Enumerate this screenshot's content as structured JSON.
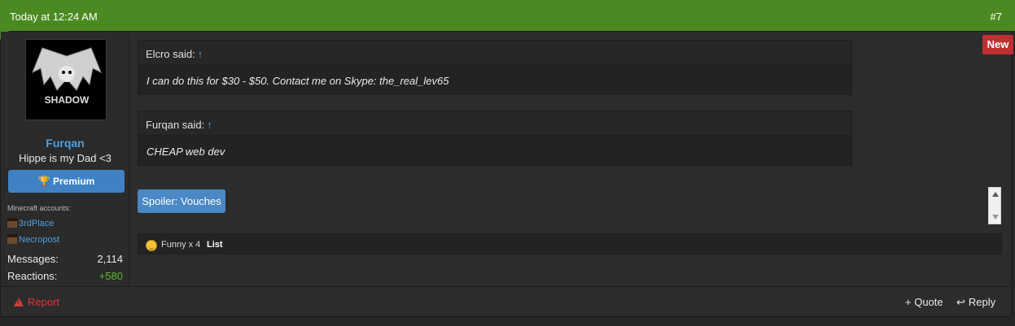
{
  "header": {
    "timestamp": "Today at 12:24 AM",
    "post_number": "#7"
  },
  "user": {
    "name": "Furqan",
    "title": "Hippe is my Dad <3",
    "badge": "Premium",
    "minecraft_label": "Minecraft accounts:",
    "accounts": [
      "3rdPlace",
      "Necropost"
    ],
    "stats": [
      {
        "label": "Messages:",
        "value": "2,114"
      },
      {
        "label": "Reactions:",
        "value": "+580"
      }
    ],
    "avatar_text": "SHADOW"
  },
  "new_badge": "New",
  "quotes": [
    {
      "author": "Elcro said:",
      "arrow": "↑",
      "text": "I can do this for $30 - $50. Contact me on Skype: the_real_lev65"
    },
    {
      "author": "Furqan said:",
      "arrow": "↑",
      "text": "CHEAP web dev"
    }
  ],
  "spoiler": "Spoiler: Vouches",
  "reactions": {
    "text": "Funny x 4",
    "list_label": "List"
  },
  "actions": {
    "report": "Report",
    "quote": "+ Quote",
    "reply": "Reply"
  },
  "colors": {
    "header": "#4b8a22",
    "link": "#4e9fe0",
    "badge": "#3f82c4",
    "new": "#c03030",
    "report": "#d93a3a",
    "positive": "#5cb82e"
  }
}
